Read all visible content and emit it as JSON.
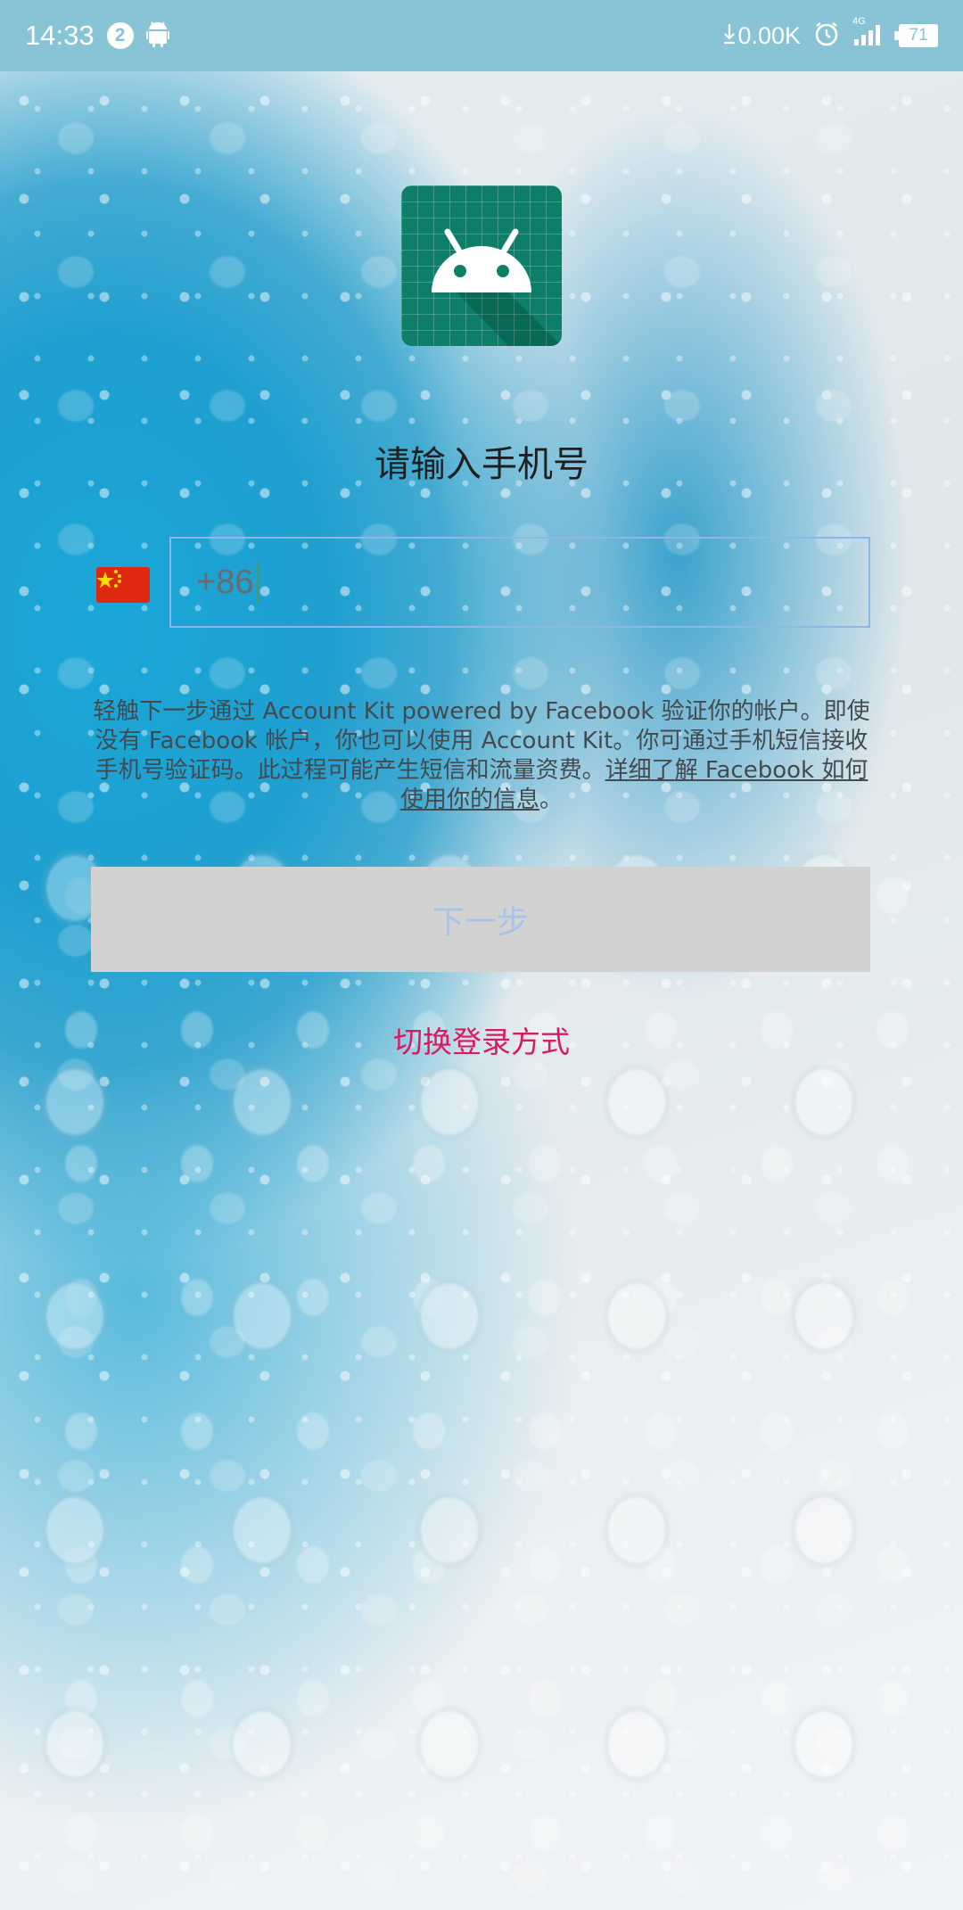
{
  "status_bar": {
    "time": "14:33",
    "notification_count": "2",
    "net_speed": "0.00K",
    "network_type": "4G",
    "battery": "71",
    "icons": [
      "android-icon",
      "download-arrow-icon",
      "alarm-icon",
      "signal-icon",
      "battery-icon"
    ]
  },
  "app": {
    "icon": "android-app-icon"
  },
  "login": {
    "title": "请输入手机号",
    "country_flag": "china-flag-icon",
    "country_code": "+86",
    "disclaimer_text": "轻触下一步通过 Account Kit powered by Facebook 验证你的帐户。即使没有 Facebook 帐户，你也可以使用 Account Kit。你可通过手机短信接收手机号验证码。此过程可能产生短信和流量资费。",
    "learn_more_link": "详细了解 Facebook 如何使用你的信息",
    "learn_more_suffix": "。",
    "next_label": "下一步",
    "switch_login_label": "切换登录方式"
  },
  "colors": {
    "status_bar_bg": "#88c4d6",
    "accent_pink": "#d81b60",
    "button_disabled_bg": "#d2d2d2",
    "button_disabled_text": "#a7c4e8",
    "input_border": "#8db7e6",
    "icon_green": "#0d7f69"
  }
}
